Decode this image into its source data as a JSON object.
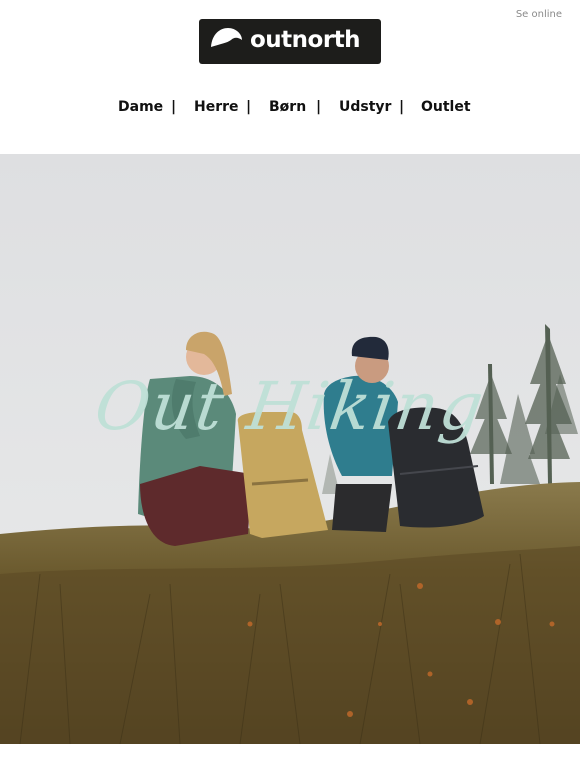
{
  "header": {
    "view_online": "Se online",
    "logo_text": "outnorth",
    "logo_registered": "®"
  },
  "nav": {
    "items": [
      {
        "label": "Dame"
      },
      {
        "label": "Herre"
      },
      {
        "label": "Børn"
      },
      {
        "label": "Udstyr"
      },
      {
        "label": "Outlet"
      }
    ],
    "separator": "|"
  },
  "hero": {
    "title": "Out Hiking",
    "colors": {
      "title": "#bfe0d7",
      "sky": "#e1e2e4",
      "ground": "#6b5a2e"
    }
  }
}
